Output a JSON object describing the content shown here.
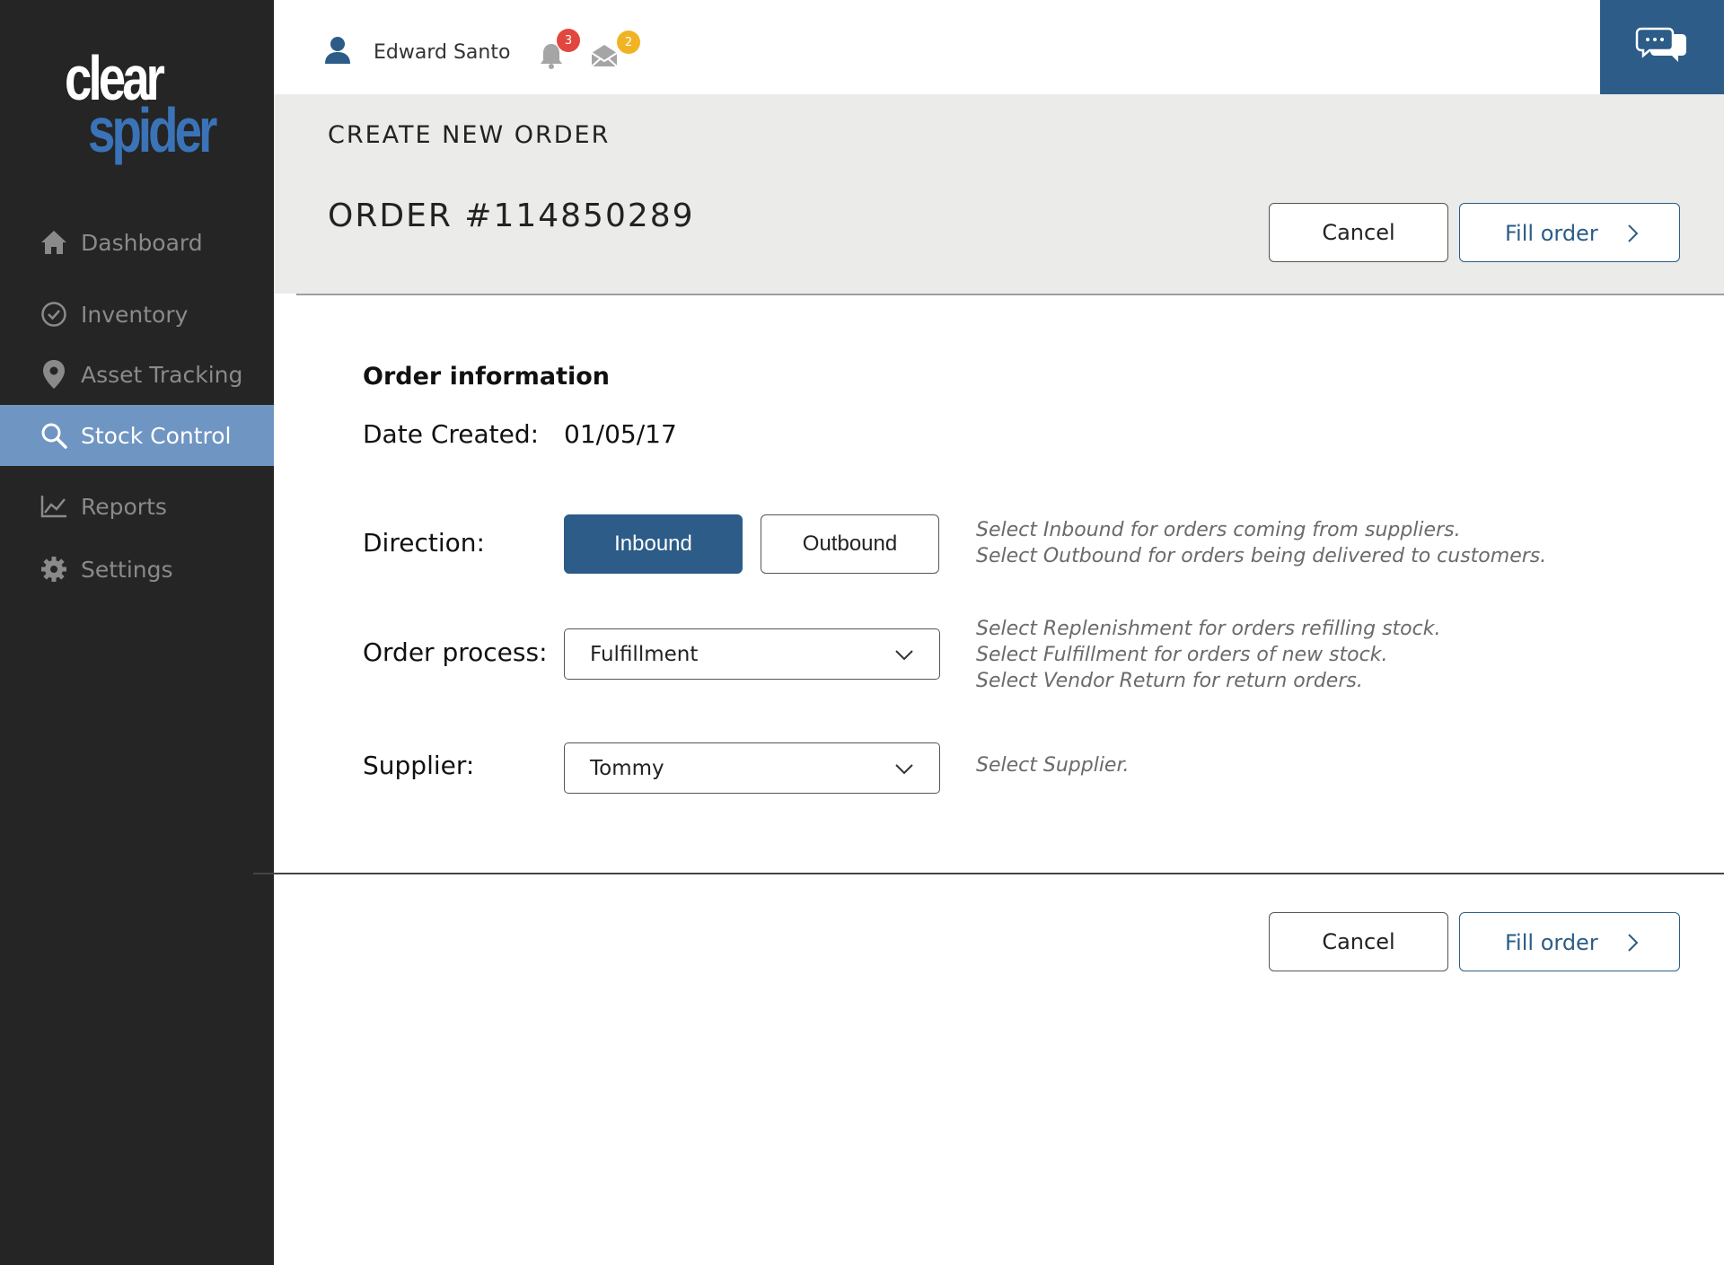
{
  "brand": {
    "logo_top": "clear",
    "logo_bottom": "spider",
    "accent_color": "#2c5c87",
    "logo_blue": "#3a73b8"
  },
  "sidebar": {
    "items": [
      {
        "label": "Dashboard",
        "icon": "home-icon",
        "active": false
      },
      {
        "label": "Inventory",
        "icon": "check-circle-icon",
        "active": false
      },
      {
        "label": "Asset Tracking",
        "icon": "map-pin-icon",
        "active": false
      },
      {
        "label": "Stock Control",
        "icon": "search-icon",
        "active": true
      },
      {
        "label": "Reports",
        "icon": "chart-icon",
        "active": false
      },
      {
        "label": "Settings",
        "icon": "gear-icon",
        "active": false
      }
    ]
  },
  "header": {
    "user_name": "Edward Santo",
    "notifications_count": "3",
    "messages_count": "2",
    "chat_icon": "chat-bubbles-icon"
  },
  "page": {
    "heading": "CREATE NEW ORDER",
    "order_number": "ORDER #114850289"
  },
  "actions": {
    "cancel_label": "Cancel",
    "fill_label": "Fill order"
  },
  "form": {
    "section_title": "Order information",
    "date_label": "Date Created:",
    "date_value": "01/05/17",
    "direction_label": "Direction:",
    "direction_options": [
      "Inbound",
      "Outbound"
    ],
    "direction_selected": "Inbound",
    "direction_hint": [
      "Select Inbound for orders coming from suppliers.",
      "Select Outbound for orders being delivered to customers."
    ],
    "process_label": "Order process:",
    "process_value": "Fulfillment",
    "process_hint": [
      "Select Replenishment for orders refilling stock.",
      "Select Fulfillment for orders of new stock.",
      "Select Vendor Return for return orders."
    ],
    "supplier_label": "Supplier:",
    "supplier_value": "Tommy",
    "supplier_hint": "Select Supplier."
  }
}
